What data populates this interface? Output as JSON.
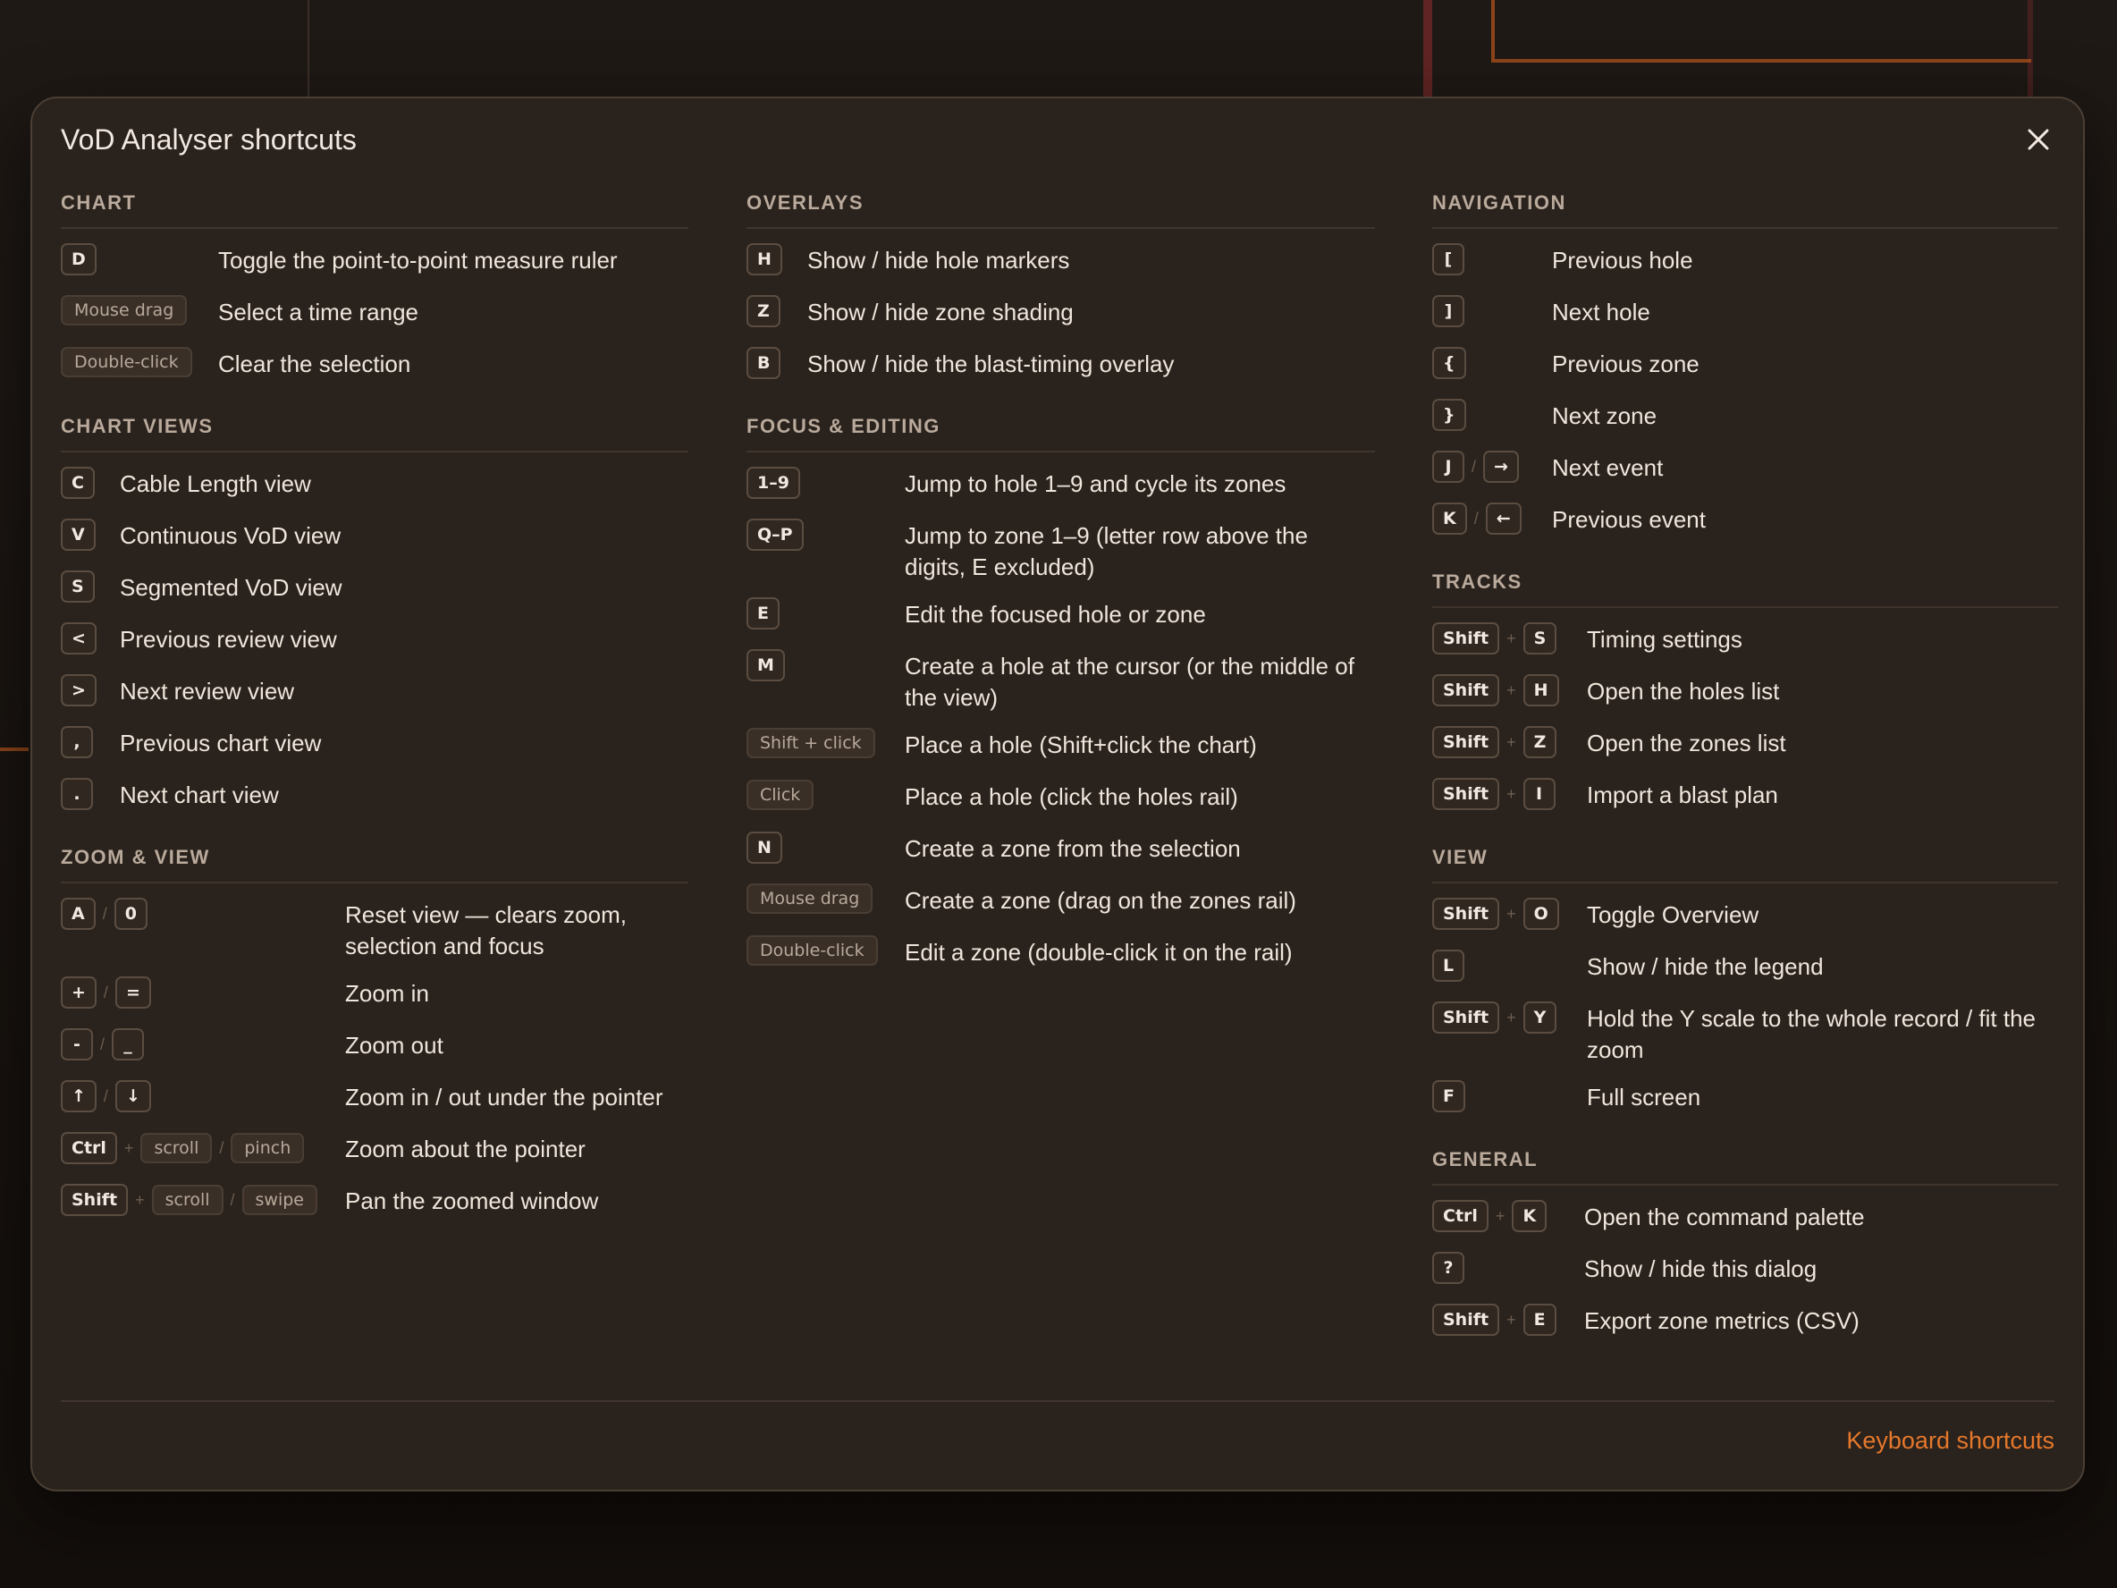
{
  "dialog": {
    "title": "VoD Analyser shortcuts",
    "footer_link": "Keyboard shortcuts",
    "accent_color": "#e5782c"
  },
  "icons": {
    "close": "close-icon"
  },
  "columns": [
    {
      "desc_offset": 0,
      "sections": [
        {
          "title": "CHART",
          "rows": [
            {
              "keys": [
                {
                  "k": "D"
                }
              ],
              "desc": "Toggle the point-to-point measure ruler"
            },
            {
              "keys": [
                {
                  "k": "Mouse drag",
                  "pill": true
                }
              ],
              "desc": "Select a time range"
            },
            {
              "keys": [
                {
                  "k": "Double-click",
                  "pill": true
                }
              ],
              "desc": "Clear the selection"
            }
          ]
        },
        {
          "title": "CHART VIEWS",
          "rows": [
            {
              "keys": [
                {
                  "k": "C"
                }
              ],
              "desc": "Cable Length view"
            },
            {
              "keys": [
                {
                  "k": "V"
                }
              ],
              "desc": "Continuous VoD view"
            },
            {
              "keys": [
                {
                  "k": "S"
                }
              ],
              "desc": "Segmented VoD view"
            },
            {
              "keys": [
                {
                  "k": "<"
                }
              ],
              "desc": "Previous review view"
            },
            {
              "keys": [
                {
                  "k": ">"
                }
              ],
              "desc": "Next review view"
            },
            {
              "keys": [
                {
                  "k": ","
                }
              ],
              "desc": "Previous chart view"
            },
            {
              "keys": [
                {
                  "k": "."
                }
              ],
              "desc": "Next chart view"
            }
          ]
        },
        {
          "title": "ZOOM & VIEW",
          "rows": [
            {
              "keys": [
                {
                  "k": "A"
                },
                {
                  "sep": "/"
                },
                {
                  "k": "0"
                }
              ],
              "desc": "Reset view — clears zoom, selection and focus"
            },
            {
              "keys": [
                {
                  "k": "+"
                },
                {
                  "sep": "/"
                },
                {
                  "k": "="
                }
              ],
              "desc": "Zoom in"
            },
            {
              "keys": [
                {
                  "k": "-"
                },
                {
                  "sep": "/"
                },
                {
                  "k": "_"
                }
              ],
              "desc": "Zoom out"
            },
            {
              "keys": [
                {
                  "k": "↑"
                },
                {
                  "sep": "/"
                },
                {
                  "k": "↓"
                }
              ],
              "desc": "Zoom in / out under the pointer"
            },
            {
              "keys": [
                {
                  "k": "Ctrl"
                },
                {
                  "sep": "+"
                },
                {
                  "k": "scroll",
                  "pill": true
                },
                {
                  "sep": "/"
                },
                {
                  "k": "pinch",
                  "pill": true
                }
              ],
              "desc": "Zoom about the pointer"
            },
            {
              "keys": [
                {
                  "k": "Shift"
                },
                {
                  "sep": "+"
                },
                {
                  "k": "scroll",
                  "pill": true
                },
                {
                  "sep": "/"
                },
                {
                  "k": "swipe",
                  "pill": true
                }
              ],
              "desc": "Pan the zoomed window"
            }
          ]
        }
      ]
    },
    {
      "sections": [
        {
          "title": "OVERLAYS",
          "rows": [
            {
              "keys": [
                {
                  "k": "H"
                }
              ],
              "desc": "Show / hide hole markers"
            },
            {
              "keys": [
                {
                  "k": "Z"
                }
              ],
              "desc": "Show / hide zone shading"
            },
            {
              "keys": [
                {
                  "k": "B"
                }
              ],
              "desc": "Show / hide the blast-timing overlay"
            }
          ]
        },
        {
          "title": "FOCUS & EDITING",
          "rows": [
            {
              "keys": [
                {
                  "k": "1–9"
                }
              ],
              "desc": "Jump to hole 1–9 and cycle its zones"
            },
            {
              "keys": [
                {
                  "k": "Q–P"
                }
              ],
              "desc": "Jump to zone 1–9 (letter row above the digits, E excluded)"
            },
            {
              "keys": [
                {
                  "k": "E"
                }
              ],
              "desc": "Edit the focused hole or zone"
            },
            {
              "keys": [
                {
                  "k": "M"
                }
              ],
              "desc": "Create a hole at the cursor (or the middle of the view)"
            },
            {
              "keys": [
                {
                  "k": "Shift + click",
                  "pill": true
                }
              ],
              "desc": "Place a hole (Shift+click the chart)"
            },
            {
              "keys": [
                {
                  "k": "Click",
                  "pill": true
                }
              ],
              "desc": "Place a hole (click the holes rail)"
            },
            {
              "keys": [
                {
                  "k": "N"
                }
              ],
              "desc": "Create a zone from the selection"
            },
            {
              "keys": [
                {
                  "k": "Mouse drag",
                  "pill": true
                }
              ],
              "desc": "Create a zone (drag on the zones rail)"
            },
            {
              "keys": [
                {
                  "k": "Double-click",
                  "pill": true
                }
              ],
              "desc": "Edit a zone (double-click it on the rail)"
            }
          ]
        }
      ]
    },
    {
      "sections": [
        {
          "title": "NAVIGATION",
          "rows": [
            {
              "keys": [
                {
                  "k": "["
                }
              ],
              "desc": "Previous hole"
            },
            {
              "keys": [
                {
                  "k": "]"
                }
              ],
              "desc": "Next hole"
            },
            {
              "keys": [
                {
                  "k": "{"
                }
              ],
              "desc": "Previous zone"
            },
            {
              "keys": [
                {
                  "k": "}"
                }
              ],
              "desc": "Next zone"
            },
            {
              "keys": [
                {
                  "k": "J"
                },
                {
                  "sep": "/"
                },
                {
                  "k": "→"
                }
              ],
              "desc": "Next event"
            },
            {
              "keys": [
                {
                  "k": "K"
                },
                {
                  "sep": "/"
                },
                {
                  "k": "←"
                }
              ],
              "desc": "Previous event"
            }
          ]
        },
        {
          "title": "TRACKS",
          "rows": [
            {
              "keys": [
                {
                  "k": "Shift"
                },
                {
                  "sep": "+"
                },
                {
                  "k": "S"
                }
              ],
              "desc": "Timing settings"
            },
            {
              "keys": [
                {
                  "k": "Shift"
                },
                {
                  "sep": "+"
                },
                {
                  "k": "H"
                }
              ],
              "desc": "Open the holes list"
            },
            {
              "keys": [
                {
                  "k": "Shift"
                },
                {
                  "sep": "+"
                },
                {
                  "k": "Z"
                }
              ],
              "desc": "Open the zones list"
            },
            {
              "keys": [
                {
                  "k": "Shift"
                },
                {
                  "sep": "+"
                },
                {
                  "k": "I"
                }
              ],
              "desc": "Import a blast plan"
            }
          ]
        },
        {
          "title": "VIEW",
          "rows": [
            {
              "keys": [
                {
                  "k": "Shift"
                },
                {
                  "sep": "+"
                },
                {
                  "k": "O"
                }
              ],
              "desc": "Toggle Overview"
            },
            {
              "keys": [
                {
                  "k": "L"
                }
              ],
              "desc": "Show / hide the legend"
            },
            {
              "keys": [
                {
                  "k": "Shift"
                },
                {
                  "sep": "+"
                },
                {
                  "k": "Y"
                }
              ],
              "desc": "Hold the Y scale to the whole record / fit the zoom"
            },
            {
              "keys": [
                {
                  "k": "F"
                }
              ],
              "desc": "Full screen"
            }
          ]
        },
        {
          "title": "GENERAL",
          "rows": [
            {
              "keys": [
                {
                  "k": "Ctrl"
                },
                {
                  "sep": "+"
                },
                {
                  "k": "K"
                }
              ],
              "desc": "Open the command palette"
            },
            {
              "keys": [
                {
                  "k": "?"
                }
              ],
              "desc": "Show / hide this dialog"
            },
            {
              "keys": [
                {
                  "k": "Shift"
                },
                {
                  "sep": "+"
                },
                {
                  "k": "E"
                }
              ],
              "desc": "Export zone metrics (CSV)"
            }
          ]
        }
      ]
    }
  ]
}
